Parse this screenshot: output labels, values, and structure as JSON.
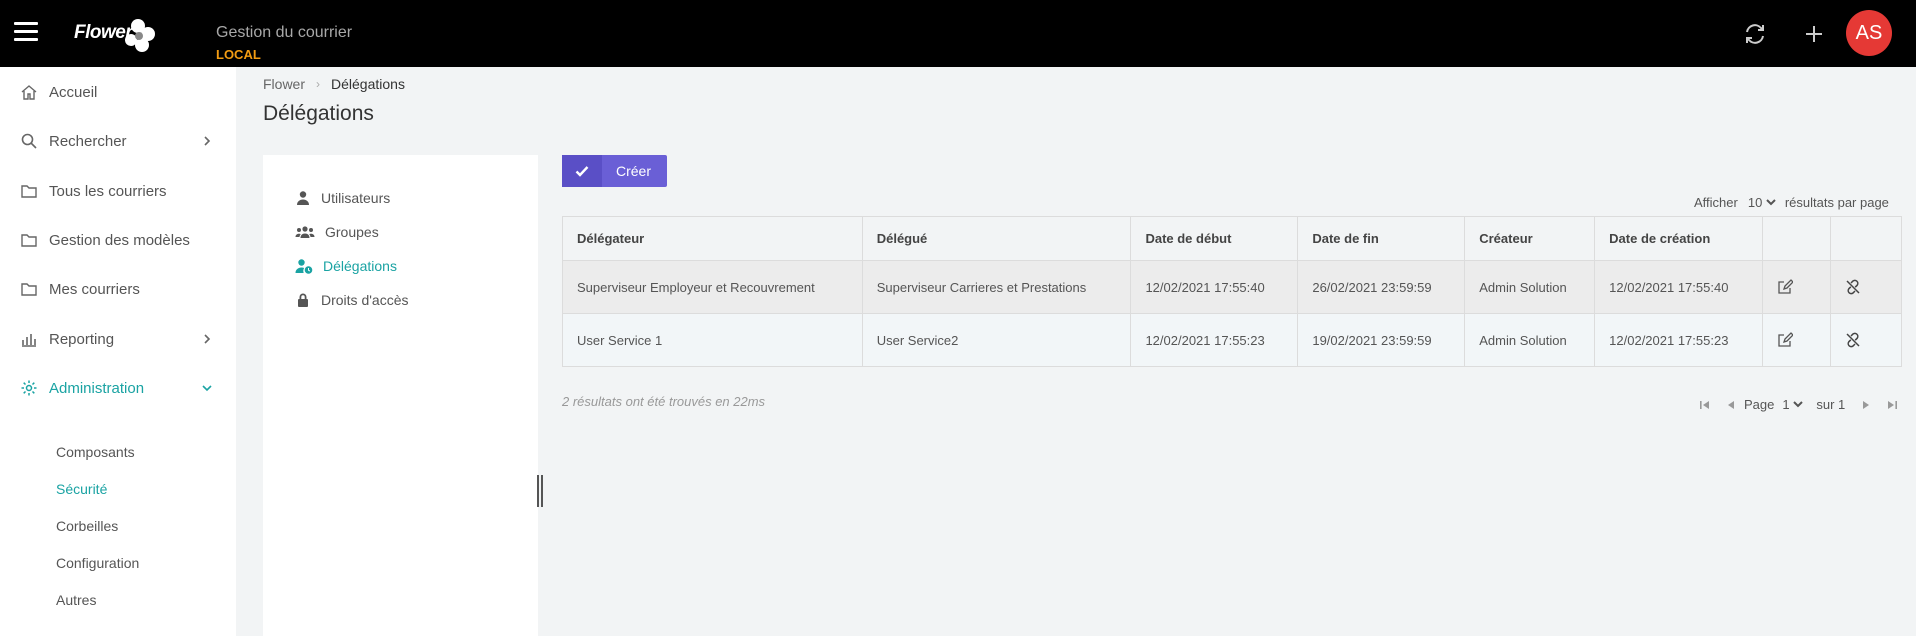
{
  "header": {
    "logo": "Flower",
    "app_title": "Gestion du courrier",
    "environment": "LOCAL",
    "avatar_initials": "AS"
  },
  "sidebar": {
    "items": [
      {
        "label": "Accueil",
        "icon": "home-icon"
      },
      {
        "label": "Rechercher",
        "icon": "search-icon",
        "expandable": true
      },
      {
        "label": "Tous les courriers",
        "icon": "folder-icon"
      },
      {
        "label": "Gestion des modèles",
        "icon": "folder-icon"
      },
      {
        "label": "Mes courriers",
        "icon": "folder-icon"
      },
      {
        "label": "Reporting",
        "icon": "bar-chart-icon",
        "expandable": true
      },
      {
        "label": "Administration",
        "icon": "gear-icon",
        "expanded": true,
        "active": true
      }
    ],
    "sub_items": [
      {
        "label": "Composants"
      },
      {
        "label": "Sécurité",
        "active": true
      },
      {
        "label": "Corbeilles"
      },
      {
        "label": "Configuration"
      },
      {
        "label": "Autres"
      }
    ]
  },
  "breadcrumb": {
    "root": "Flower",
    "current": "Délégations"
  },
  "page_title": "Délégations",
  "security_menu": {
    "items": [
      {
        "label": "Utilisateurs",
        "icon": "user-icon"
      },
      {
        "label": "Groupes",
        "icon": "users-icon"
      },
      {
        "label": "Délégations",
        "icon": "user-clock-icon",
        "active": true
      },
      {
        "label": "Droits d'accès",
        "icon": "lock-icon"
      }
    ]
  },
  "toolbar": {
    "create_label": "Créer"
  },
  "page_size": {
    "prefix": "Afficher",
    "value": "10",
    "suffix": "résultats par page"
  },
  "table": {
    "columns": [
      "Délégateur",
      "Délégué",
      "Date de début",
      "Date de fin",
      "Créateur",
      "Date de création",
      "",
      ""
    ],
    "rows": [
      [
        "Superviseur Employeur et Recouvrement",
        "Superviseur Carrieres et Prestations",
        "12/02/2021 17:55:40",
        "26/02/2021 23:59:59",
        "Admin Solution",
        "12/02/2021 17:55:40"
      ],
      [
        "User Service 1",
        "User Service2",
        "12/02/2021 17:55:23",
        "19/02/2021 23:59:59",
        "Admin Solution",
        "12/02/2021 17:55:23"
      ]
    ]
  },
  "footer": {
    "result_count": "2 résultats ont été trouvés en 22ms",
    "page_label": "Page",
    "page_value": "1",
    "of_label": "sur 1"
  },
  "colors": {
    "accent": "#1aa3a3",
    "create_button": "#6a5fd6",
    "environment": "#f39c12",
    "avatar": "#e53935"
  }
}
